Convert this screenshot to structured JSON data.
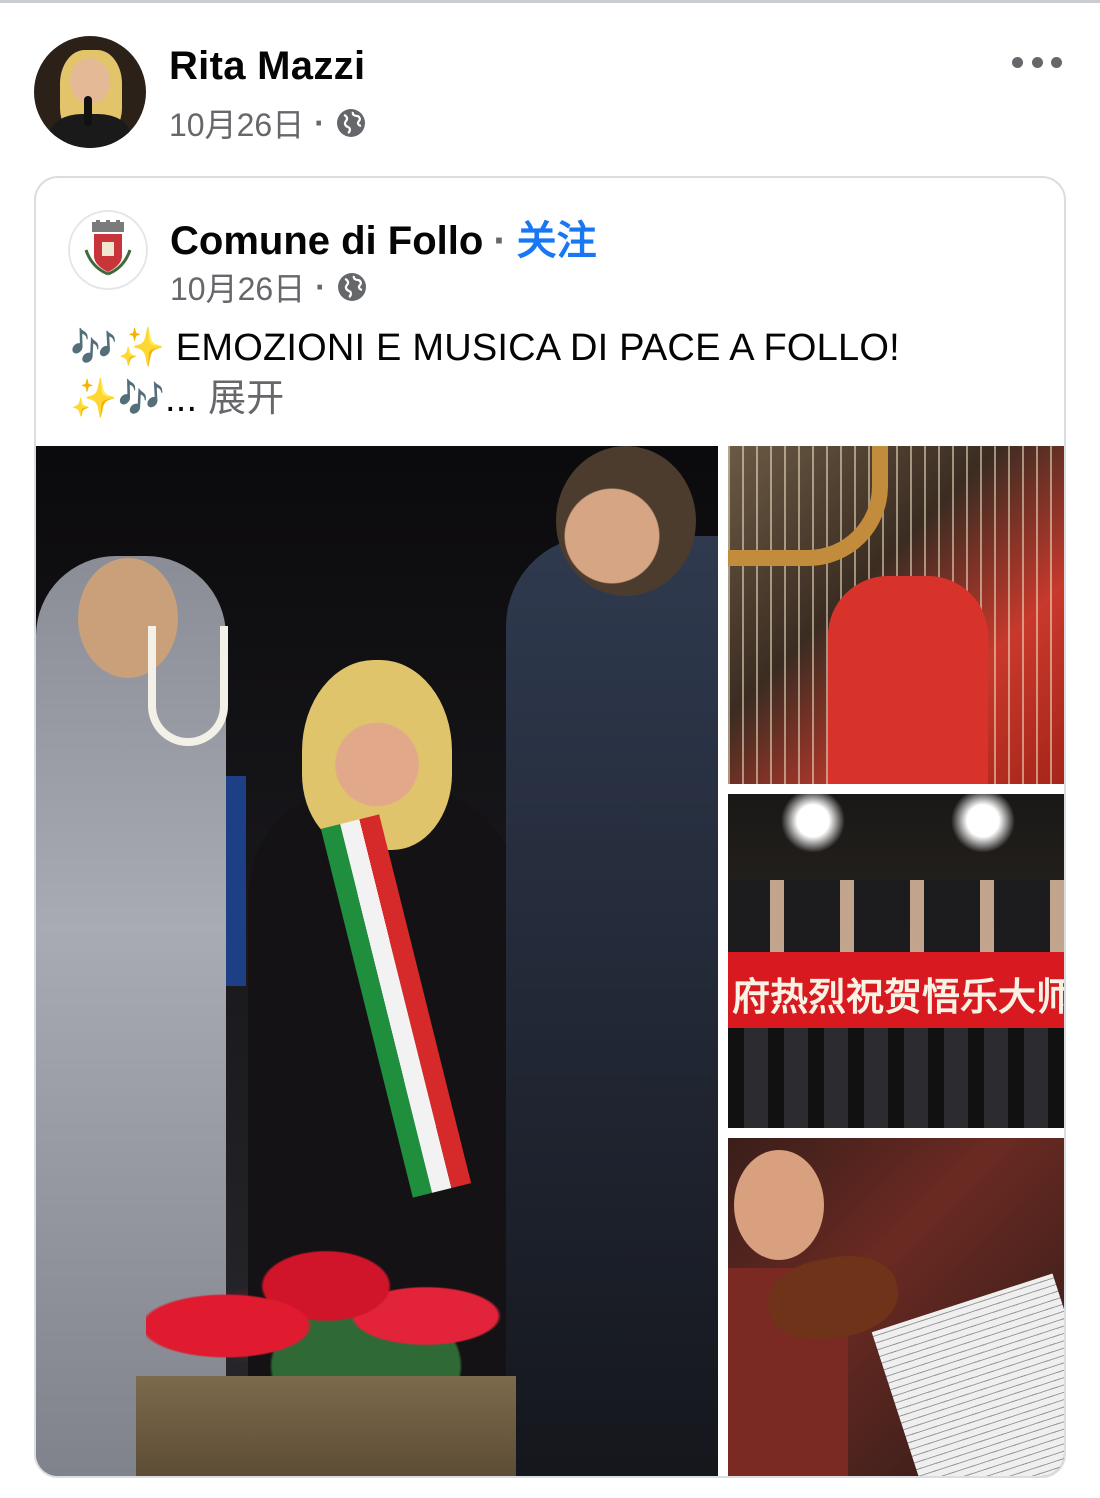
{
  "post": {
    "author_name": "Rita Mazzi",
    "date": "10月26日",
    "meta_separator": "·"
  },
  "shared": {
    "page_name": "Comune di Follo",
    "name_separator": "·",
    "follow_label": "关注",
    "date": "10月26日",
    "meta_separator": "·",
    "text_emoji_start": "🎶✨",
    "text_main": "EMOZIONI E MUSICA DI PACE A FOLLO!",
    "text_emoji_end": "✨🎶",
    "ellipsis": "...",
    "see_more": "展开",
    "banner_text": "府热烈祝贺悟乐大师"
  },
  "icons": {
    "privacy": "globe-icon",
    "options": "more-options-icon"
  },
  "colors": {
    "link": "#1877f2",
    "secondary_text": "#65676b",
    "card_border": "#dadde1"
  }
}
